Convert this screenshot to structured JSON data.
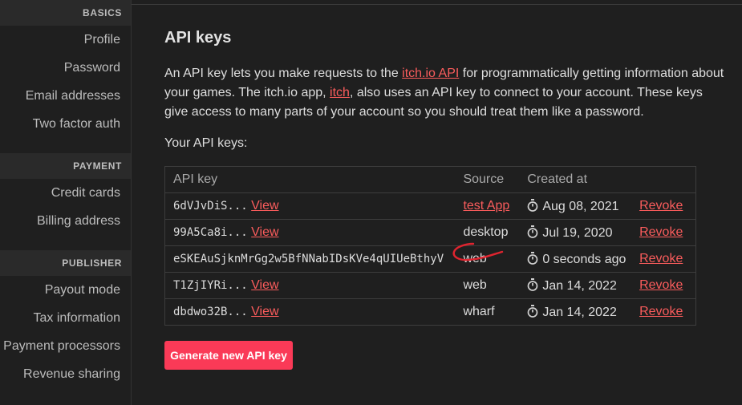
{
  "sidebar": {
    "groups": [
      {
        "header": "BASICS",
        "items": [
          "Profile",
          "Password",
          "Email addresses",
          "Two factor auth"
        ]
      },
      {
        "header": "PAYMENT",
        "items": [
          "Credit cards",
          "Billing address"
        ]
      },
      {
        "header": "PUBLISHER",
        "items": [
          "Payout mode",
          "Tax information",
          "Payment processors",
          "Revenue sharing"
        ]
      }
    ]
  },
  "main": {
    "title": "API keys",
    "desc_part1": "An API key lets you make requests to the ",
    "desc_link1": "itch.io API",
    "desc_part2": " for programmatically getting information about your games. The itch.io app, ",
    "desc_link2": "itch",
    "desc_part3": ", also uses an API key to connect to your account. These keys give access to many parts of your account so you should treat them like a password.",
    "your_keys_label": "Your API keys:",
    "table": {
      "headers": [
        "API key",
        "Source",
        "Created at",
        ""
      ],
      "rows": [
        {
          "key": "6dVJvDiS...",
          "view": "View",
          "source": "test App",
          "source_is_link": true,
          "created": "Aug 08, 2021",
          "revoke": "Revoke"
        },
        {
          "key": "99A5Ca8i...",
          "view": "View",
          "source": "desktop",
          "source_is_link": false,
          "created": "Jul 19, 2020",
          "revoke": "Revoke"
        },
        {
          "key": "eSKEAuSjknMrGg2w5BfNNabIDsKVe4qUIUeBthyV",
          "view": "",
          "source": "web",
          "source_is_link": false,
          "created": "0 seconds ago",
          "revoke": "Revoke"
        },
        {
          "key": "T1ZjIYRi...",
          "view": "View",
          "source": "web",
          "source_is_link": false,
          "created": "Jan 14, 2022",
          "revoke": "Revoke"
        },
        {
          "key": "dbdwo32B...",
          "view": "View",
          "source": "wharf",
          "source_is_link": false,
          "created": "Jan 14, 2022",
          "revoke": "Revoke"
        }
      ]
    },
    "generate_button": "Generate new API key"
  },
  "colors": {
    "accent": "#fa5c5c",
    "button": "#fa3a57",
    "background": "#1f1f1f",
    "annotation": "#e0242f"
  },
  "icons": {
    "created_at": "stopwatch-icon"
  }
}
